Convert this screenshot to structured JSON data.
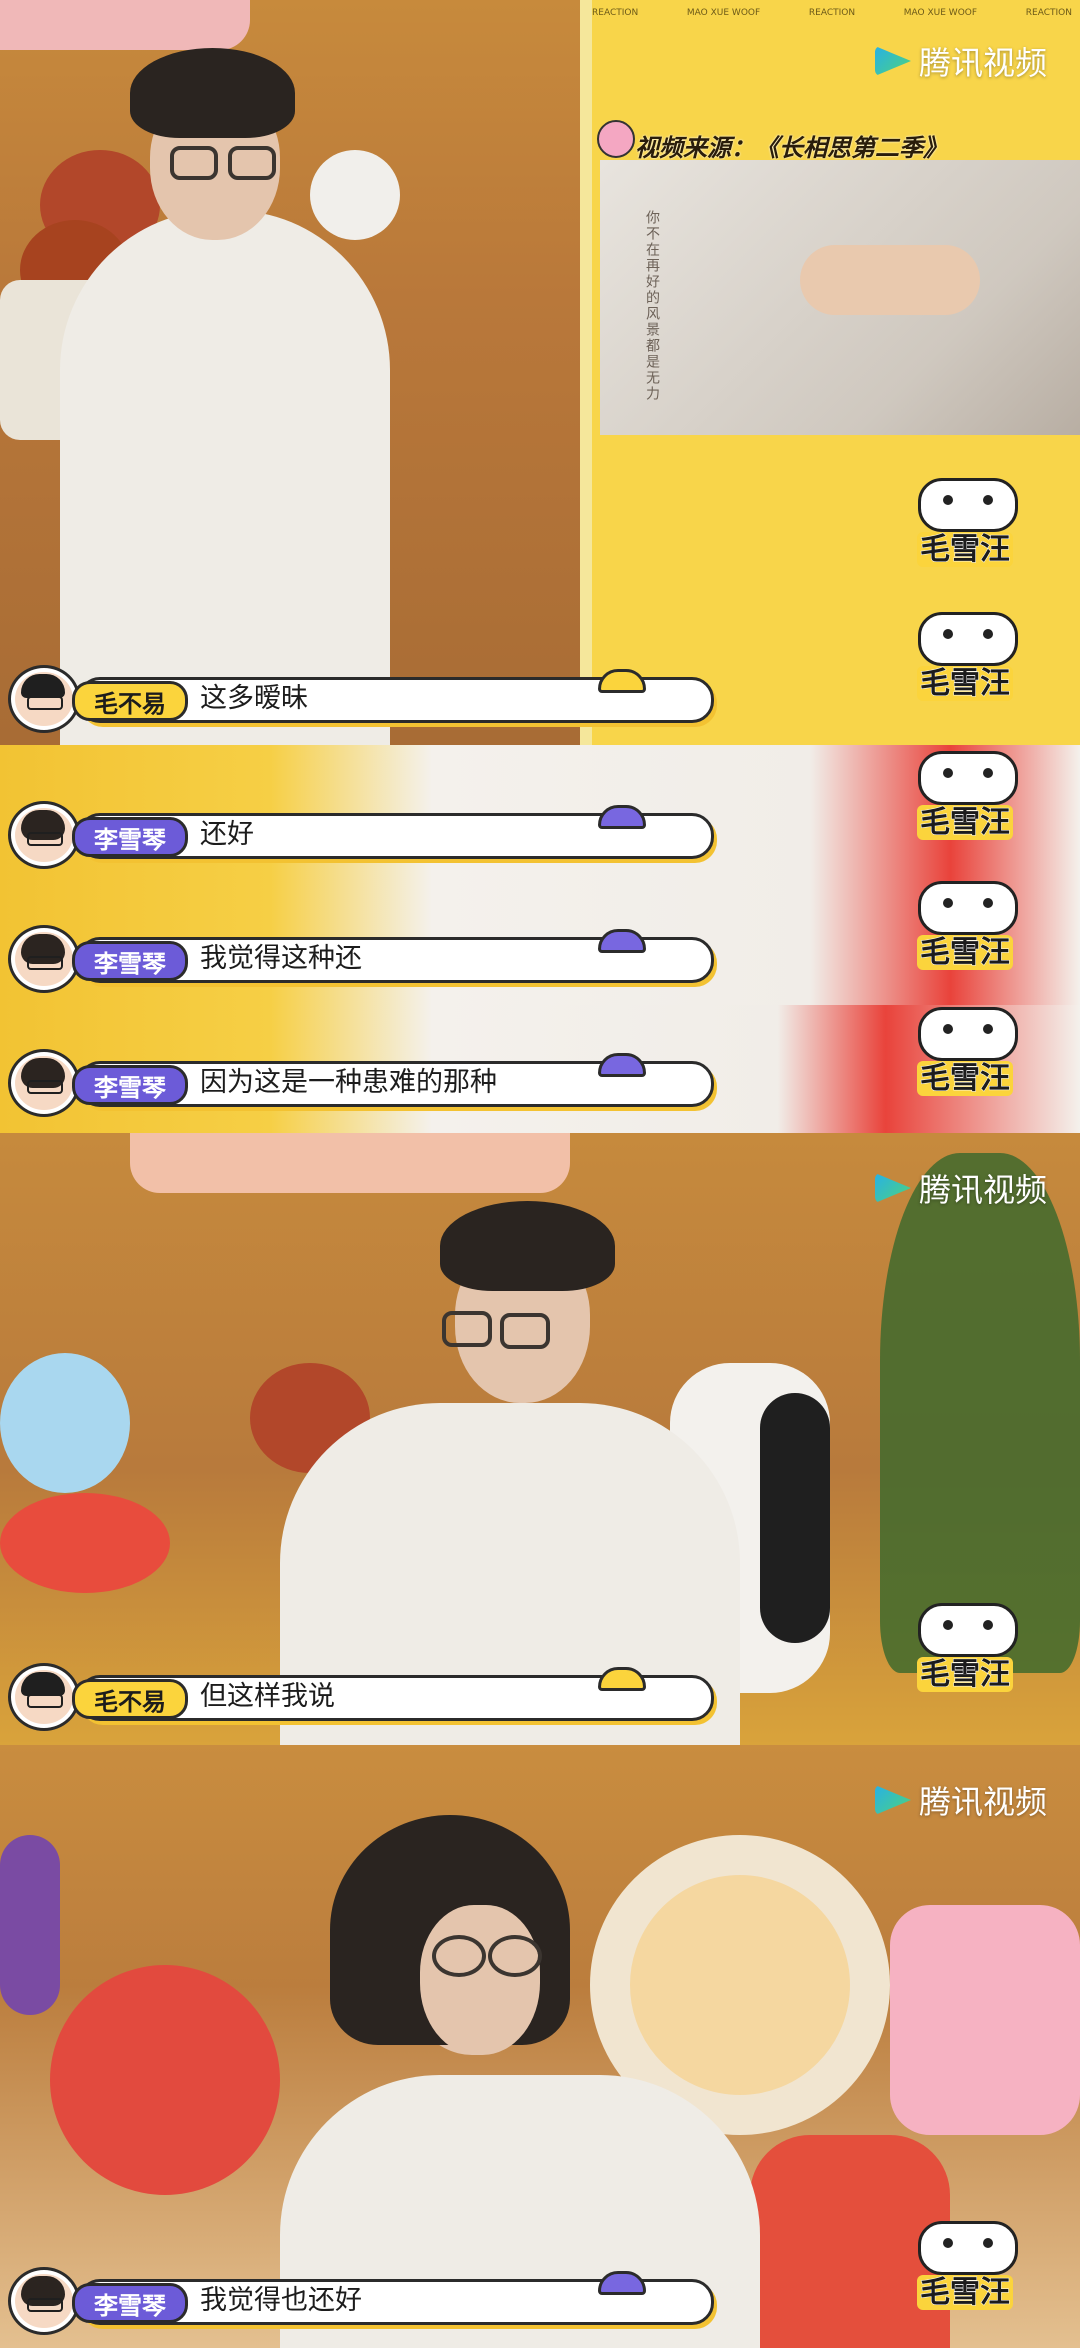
{
  "watermark": {
    "tencent": "腾讯视频",
    "show": "毛雪汪"
  },
  "clip": {
    "source_label": "视频来源：《长相思第二季》",
    "drama_caption": "你不在再好的风景都是无力",
    "ticker": [
      "REACTION",
      "MAO XUE WOOF",
      "REACTION",
      "MAO XUE WOOF",
      "REACTION"
    ]
  },
  "subtitles": [
    {
      "speaker": "毛不易",
      "text": "这多暧昧"
    },
    {
      "speaker": "李雪琴",
      "text": "还好"
    },
    {
      "speaker": "李雪琴",
      "text": "我觉得这种还"
    },
    {
      "speaker": "李雪琴",
      "text": "因为这是一种患难的那种"
    },
    {
      "speaker": "毛不易",
      "text": "但这样我说"
    },
    {
      "speaker": "李雪琴",
      "text": "我觉得也还好"
    }
  ],
  "colors": {
    "tag_purple": "#6c5bd8",
    "tag_yellow": "#fbd43c",
    "brand_yellow": "#f8d54a"
  }
}
